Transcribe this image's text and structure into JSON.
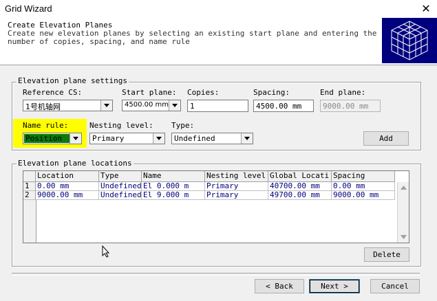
{
  "window": {
    "title": "Grid Wizard",
    "close_glyph": "✕"
  },
  "header": {
    "title": "Create Elevation Planes",
    "description": "Create new elevation planes by selecting an existing start plane and entering the number of copies, spacing, and name rule"
  },
  "settings": {
    "legend": "Elevation plane settings",
    "reference_cs": {
      "label": "Reference CS:",
      "value": "1号机轴网"
    },
    "start_plane": {
      "label": "Start plane:",
      "value": "4500.00 mm"
    },
    "copies": {
      "label": "Copies:",
      "value": "1"
    },
    "spacing": {
      "label": "Spacing:",
      "value": "4500.00 mm"
    },
    "end_plane": {
      "label": "End plane:",
      "value": "9000.00 mm"
    },
    "name_rule": {
      "label": "Name rule:",
      "value": "Position"
    },
    "nesting_level": {
      "label": "Nesting level:",
      "value": "Primary"
    },
    "type": {
      "label": "Type:",
      "value": "Undefined"
    },
    "add_label": "Add"
  },
  "locations": {
    "legend": "Elevation plane locations",
    "columns": [
      "Location",
      "Type",
      "Name",
      "Nesting level",
      "Global Locati",
      "Spacing"
    ],
    "rows": [
      {
        "num": "1",
        "cells": [
          "0.00 mm",
          "Undefined",
          "El 0.000 m",
          "Primary",
          "40700.00 mm",
          "0.00 mm"
        ]
      },
      {
        "num": "2",
        "cells": [
          "9000.00 mm",
          "Undefined",
          "El 9.000 m",
          "Primary",
          "49700.00 mm",
          "9000.00 mm"
        ]
      }
    ],
    "delete_label": "Delete"
  },
  "footer": {
    "back_label": "< Back",
    "next_label": "Next >",
    "cancel_label": "Cancel"
  },
  "colors": {
    "highlight": "#ffff00",
    "header_logo": "#00007f",
    "grid_text": "#00007f"
  }
}
